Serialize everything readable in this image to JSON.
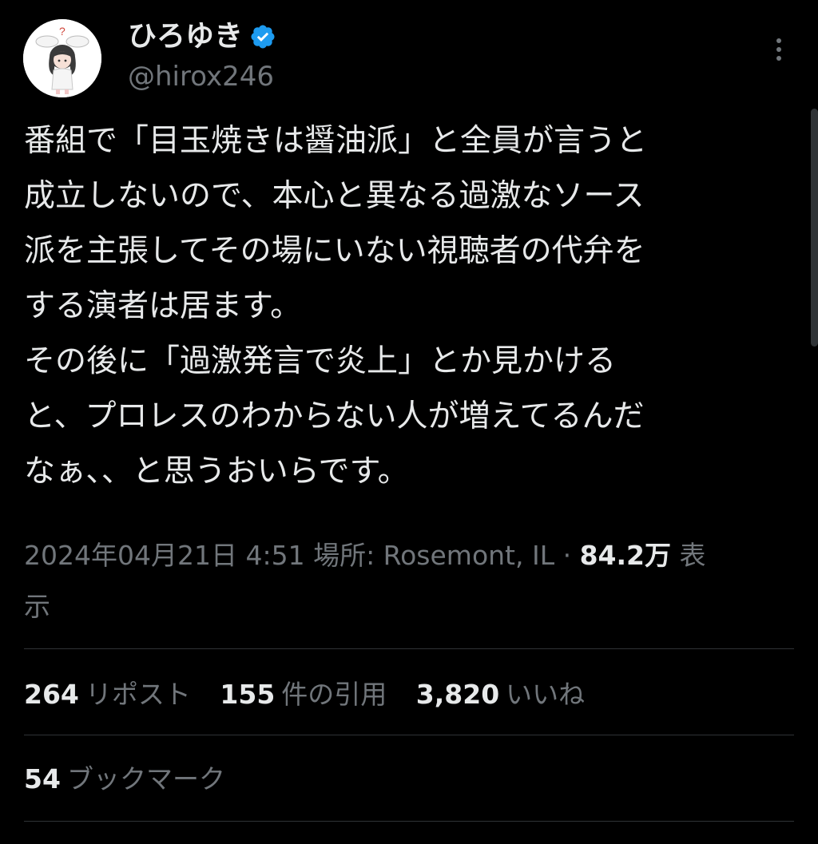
{
  "author": {
    "display_name": "ひろゆき",
    "handle": "@hirox246",
    "avatar_icon": "avatar-illustration",
    "verified_icon": "verified-badge-icon",
    "verified_color": "#1d9bf0"
  },
  "menu": {
    "more_icon": "more-vertical-icon"
  },
  "tweet": {
    "lines": [
      "番組で「目玉焼きは醤油派」と全員が言うと",
      "成立しないので、本心と異なる過激なソース",
      "派を主張してその場にいない視聴者の代弁を",
      "する演者は居ます。",
      "その後に「過激発言で炎上」とか見かける",
      "と、プロレスのわからない人が増えてるんだ",
      "なぁ、、と思うおいらです。"
    ]
  },
  "meta": {
    "datetime": "2024年04月21日 4:51",
    "location": "場所: Rosemont, IL",
    "separator": "·",
    "views_count": "84.2万",
    "views_label_1": "表",
    "views_label_2": "示"
  },
  "stats": {
    "reposts": {
      "count": "264",
      "label": "リポスト"
    },
    "quotes": {
      "count": "155",
      "label": "件の引用"
    },
    "likes": {
      "count": "3,820",
      "label": "いいね"
    },
    "bookmarks": {
      "count": "54",
      "label": "ブックマーク"
    }
  },
  "colors": {
    "background": "#000000",
    "text_primary": "#e7e9ea",
    "text_secondary": "#71767b",
    "divider": "#2f3336"
  }
}
